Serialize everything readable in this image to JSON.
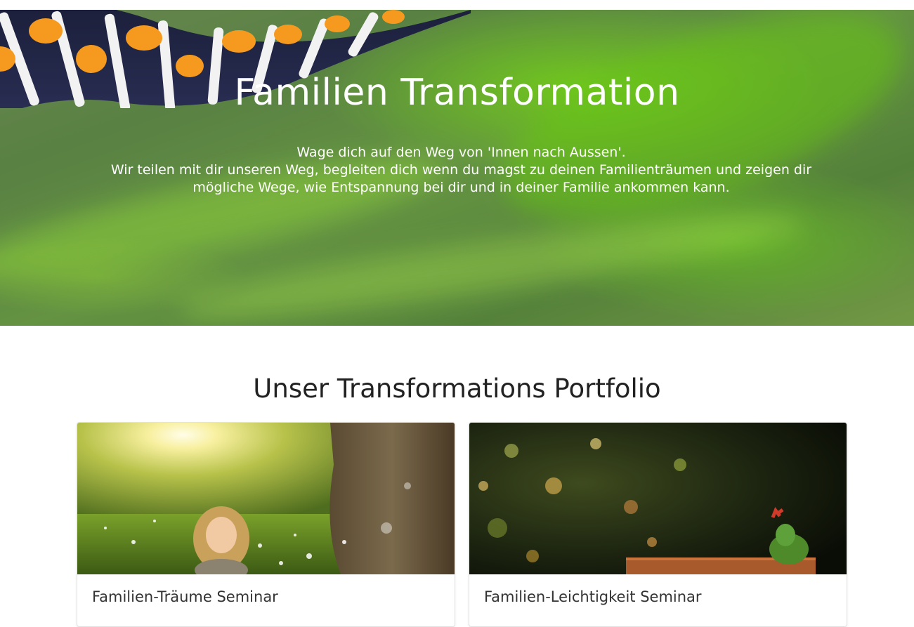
{
  "hero": {
    "title": "Familien Transformation",
    "line1": "Wage dich auf den Weg von 'Innen nach Aussen'.",
    "line2": "Wir teilen mit dir unseren Weg, begleiten dich wenn du magst zu deinen Familienträumen und zeigen dir mögliche Wege, wie Entspannung bei dir und in deiner Familie ankommen kann."
  },
  "portfolio": {
    "title": "Unser Transformations Portfolio",
    "cards": [
      {
        "title": "Familien-Träume Seminar",
        "image": "girl-in-sunny-meadow"
      },
      {
        "title": "Familien-Leichtigkeit Seminar",
        "image": "frog-figurines-on-box"
      }
    ]
  },
  "colors": {
    "hero_green": "#6b9d47",
    "accent_lime": "#78d71e",
    "heading_text": "#222222"
  }
}
